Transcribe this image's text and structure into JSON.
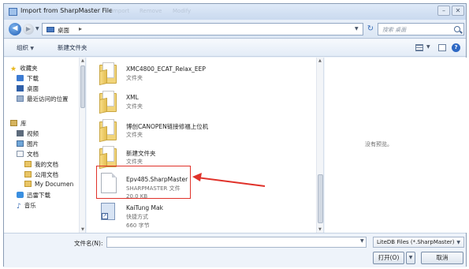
{
  "window": {
    "title": "Import from SharpMaster File",
    "faded_menu": [
      "Import",
      "Remove",
      "Modify"
    ],
    "minimize": "–",
    "maximize": "□",
    "close": "✕"
  },
  "address": {
    "back": "◀",
    "forward": "▶",
    "location": "桌面",
    "chevron": "▸",
    "refresh": "↻",
    "search_placeholder": "搜索 桌面"
  },
  "toolbar": {
    "organize": "组织",
    "new_folder": "新建文件夹",
    "help": "?"
  },
  "sidebar": {
    "favorites": "收藏夹",
    "items": [
      {
        "label": "下载",
        "icon": "download-icon"
      },
      {
        "label": "桌面",
        "icon": "desktop-icon"
      },
      {
        "label": "最近访问的位置",
        "icon": "recent-places-icon"
      }
    ],
    "library": "库",
    "library_items": [
      {
        "label": "视频",
        "icon": "video-icon"
      },
      {
        "label": "图片",
        "icon": "picture-icon"
      },
      {
        "label": "文档",
        "icon": "document-icon"
      },
      {
        "label": "我的文档",
        "icon": "folder-icon"
      },
      {
        "label": "公用文档",
        "icon": "folder-icon"
      },
      {
        "label": "My Documen",
        "icon": "folder-icon"
      }
    ],
    "other_items": [
      {
        "label": "迅雷下载",
        "icon": "xunlei-icon"
      },
      {
        "label": "音乐",
        "icon": "music-icon"
      }
    ]
  },
  "files": [
    {
      "name": "XMC4800_ECAT_Relax_EEP",
      "type": "文件夹",
      "size": "",
      "kind": "folder"
    },
    {
      "name": "XML",
      "type": "文件夹",
      "size": "",
      "kind": "folder"
    },
    {
      "name": "博创CANOPEN链接修福上位机",
      "type": "文件夹",
      "size": "",
      "kind": "folder"
    },
    {
      "name": "新建文件夹",
      "type": "文件夹",
      "size": "",
      "kind": "folder"
    },
    {
      "name": "Epv485.SharpMaster",
      "type": "SHARPMASTER 文件",
      "size": "20.0 KB",
      "kind": "file"
    },
    {
      "name": "KaiTung Mak",
      "type": "快捷方式",
      "size": "660 字节",
      "kind": "shortcut"
    }
  ],
  "preview": {
    "empty_text": "没有预览。"
  },
  "bottom": {
    "filename_label": "文件名(N):",
    "filename_value": "",
    "filter": "LiteDB Files (*.SharpMaster)",
    "open": "打开(O)",
    "cancel": "取消"
  },
  "colors": {
    "annotation_red": "#e0322a",
    "window_frame": "#8a9cb4",
    "selection_accent": "#2d68c4"
  }
}
